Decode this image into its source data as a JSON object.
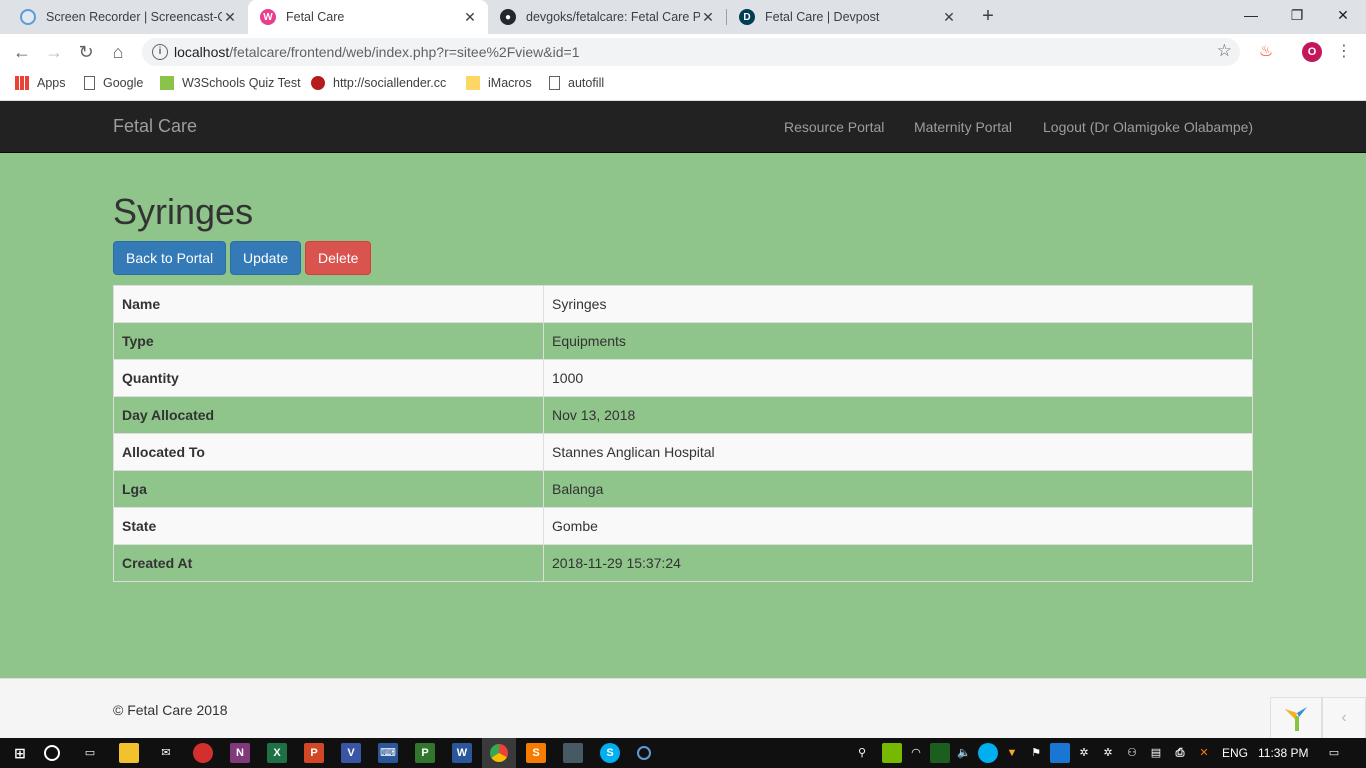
{
  "browser": {
    "tabs": [
      {
        "title": "Screen Recorder | Screencast-O-M",
        "favicon": "screencast-icon",
        "color": "#5e9cd3"
      },
      {
        "title": "Fetal Care",
        "favicon": "yii-icon",
        "color": "#e83e8c"
      },
      {
        "title": "devgoks/fetalcare: Fetal Care Pro",
        "favicon": "github-icon",
        "color": "#24292e"
      },
      {
        "title": "Fetal Care | Devpost",
        "favicon": "devpost-icon",
        "color": "#003e54"
      }
    ],
    "url_host": "localhost",
    "url_path": "/fetalcare/frontend/web/index.php?r=sitee%2Fview&id=1",
    "profile_initial": "O",
    "bookmarks": [
      {
        "label": "Apps",
        "icon": "apps-grid-icon"
      },
      {
        "label": "Google",
        "icon": "page-icon"
      },
      {
        "label": "W3Schools Quiz Test",
        "icon": "w3schools-icon"
      },
      {
        "label": "http://sociallender.cc",
        "icon": "sociallender-icon"
      },
      {
        "label": "iMacros",
        "icon": "folder-icon"
      },
      {
        "label": "autofill",
        "icon": "page-icon"
      }
    ]
  },
  "site": {
    "brand": "Fetal Care",
    "nav": [
      "Resource Portal",
      "Maternity Portal",
      "Logout (Dr Olamigoke Olabampe)"
    ]
  },
  "page": {
    "title": "Syringes",
    "buttons": {
      "back": "Back to Portal",
      "update": "Update",
      "delete": "Delete"
    },
    "details": [
      {
        "label": "Name",
        "value": "Syringes"
      },
      {
        "label": "Type",
        "value": "Equipments"
      },
      {
        "label": "Quantity",
        "value": "1000"
      },
      {
        "label": "Day Allocated",
        "value": "Nov 13, 2018"
      },
      {
        "label": "Allocated To",
        "value": "Stannes Anglican Hospital"
      },
      {
        "label": "Lga",
        "value": "Balanga"
      },
      {
        "label": "State",
        "value": "Gombe"
      },
      {
        "label": "Created At",
        "value": "2018-11-29 15:37:24"
      }
    ]
  },
  "footer": {
    "text": "© Fetal Care 2018"
  },
  "taskbar": {
    "language": "ENG",
    "time": "11:38 PM"
  },
  "colors": {
    "page_bg": "#8fc48b",
    "navbar": "#222222",
    "primary": "#337ab7",
    "danger": "#d9534f"
  }
}
